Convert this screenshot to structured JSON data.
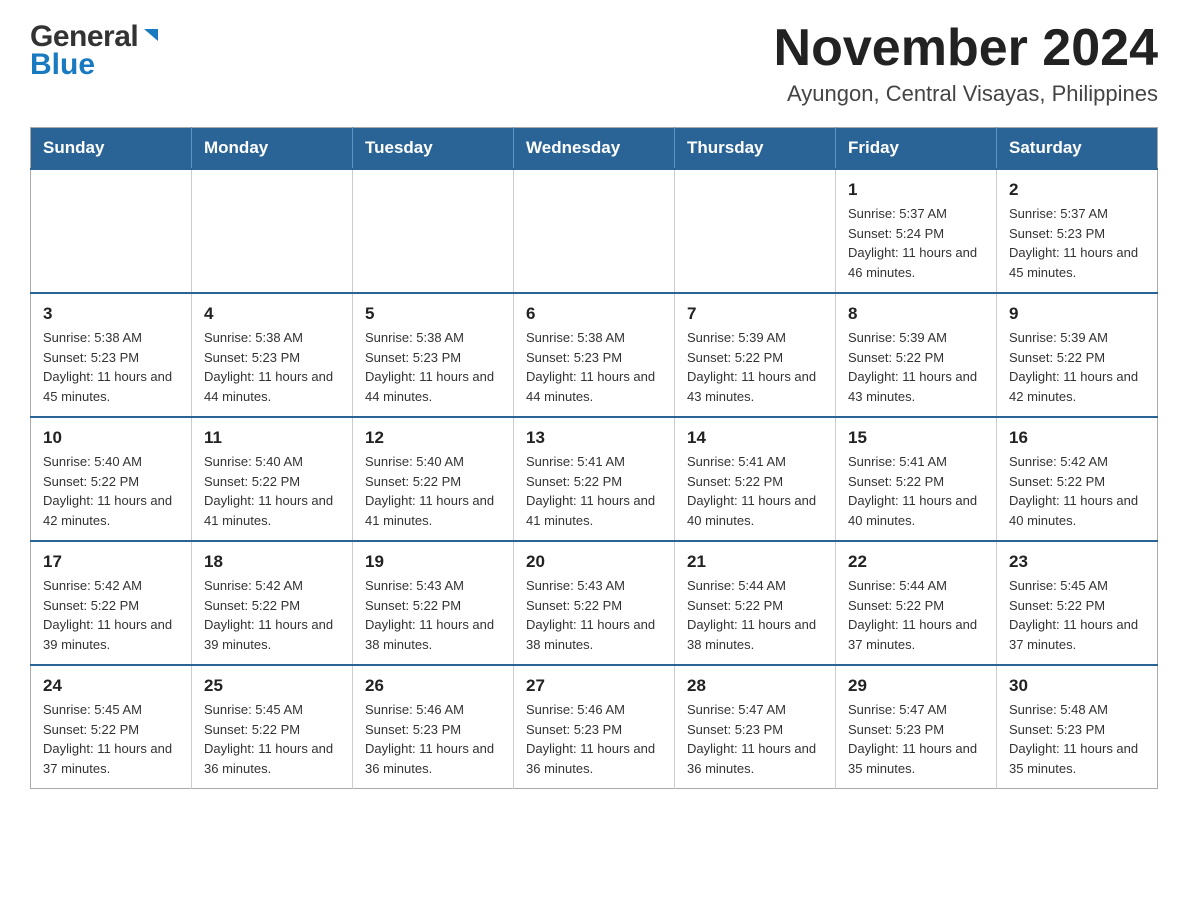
{
  "logo": {
    "general": "General",
    "blue": "Blue"
  },
  "header": {
    "month": "November 2024",
    "location": "Ayungon, Central Visayas, Philippines"
  },
  "weekdays": [
    "Sunday",
    "Monday",
    "Tuesday",
    "Wednesday",
    "Thursday",
    "Friday",
    "Saturday"
  ],
  "weeks": [
    [
      {
        "day": "",
        "info": ""
      },
      {
        "day": "",
        "info": ""
      },
      {
        "day": "",
        "info": ""
      },
      {
        "day": "",
        "info": ""
      },
      {
        "day": "",
        "info": ""
      },
      {
        "day": "1",
        "info": "Sunrise: 5:37 AM\nSunset: 5:24 PM\nDaylight: 11 hours and 46 minutes."
      },
      {
        "day": "2",
        "info": "Sunrise: 5:37 AM\nSunset: 5:23 PM\nDaylight: 11 hours and 45 minutes."
      }
    ],
    [
      {
        "day": "3",
        "info": "Sunrise: 5:38 AM\nSunset: 5:23 PM\nDaylight: 11 hours and 45 minutes."
      },
      {
        "day": "4",
        "info": "Sunrise: 5:38 AM\nSunset: 5:23 PM\nDaylight: 11 hours and 44 minutes."
      },
      {
        "day": "5",
        "info": "Sunrise: 5:38 AM\nSunset: 5:23 PM\nDaylight: 11 hours and 44 minutes."
      },
      {
        "day": "6",
        "info": "Sunrise: 5:38 AM\nSunset: 5:23 PM\nDaylight: 11 hours and 44 minutes."
      },
      {
        "day": "7",
        "info": "Sunrise: 5:39 AM\nSunset: 5:22 PM\nDaylight: 11 hours and 43 minutes."
      },
      {
        "day": "8",
        "info": "Sunrise: 5:39 AM\nSunset: 5:22 PM\nDaylight: 11 hours and 43 minutes."
      },
      {
        "day": "9",
        "info": "Sunrise: 5:39 AM\nSunset: 5:22 PM\nDaylight: 11 hours and 42 minutes."
      }
    ],
    [
      {
        "day": "10",
        "info": "Sunrise: 5:40 AM\nSunset: 5:22 PM\nDaylight: 11 hours and 42 minutes."
      },
      {
        "day": "11",
        "info": "Sunrise: 5:40 AM\nSunset: 5:22 PM\nDaylight: 11 hours and 41 minutes."
      },
      {
        "day": "12",
        "info": "Sunrise: 5:40 AM\nSunset: 5:22 PM\nDaylight: 11 hours and 41 minutes."
      },
      {
        "day": "13",
        "info": "Sunrise: 5:41 AM\nSunset: 5:22 PM\nDaylight: 11 hours and 41 minutes."
      },
      {
        "day": "14",
        "info": "Sunrise: 5:41 AM\nSunset: 5:22 PM\nDaylight: 11 hours and 40 minutes."
      },
      {
        "day": "15",
        "info": "Sunrise: 5:41 AM\nSunset: 5:22 PM\nDaylight: 11 hours and 40 minutes."
      },
      {
        "day": "16",
        "info": "Sunrise: 5:42 AM\nSunset: 5:22 PM\nDaylight: 11 hours and 40 minutes."
      }
    ],
    [
      {
        "day": "17",
        "info": "Sunrise: 5:42 AM\nSunset: 5:22 PM\nDaylight: 11 hours and 39 minutes."
      },
      {
        "day": "18",
        "info": "Sunrise: 5:42 AM\nSunset: 5:22 PM\nDaylight: 11 hours and 39 minutes."
      },
      {
        "day": "19",
        "info": "Sunrise: 5:43 AM\nSunset: 5:22 PM\nDaylight: 11 hours and 38 minutes."
      },
      {
        "day": "20",
        "info": "Sunrise: 5:43 AM\nSunset: 5:22 PM\nDaylight: 11 hours and 38 minutes."
      },
      {
        "day": "21",
        "info": "Sunrise: 5:44 AM\nSunset: 5:22 PM\nDaylight: 11 hours and 38 minutes."
      },
      {
        "day": "22",
        "info": "Sunrise: 5:44 AM\nSunset: 5:22 PM\nDaylight: 11 hours and 37 minutes."
      },
      {
        "day": "23",
        "info": "Sunrise: 5:45 AM\nSunset: 5:22 PM\nDaylight: 11 hours and 37 minutes."
      }
    ],
    [
      {
        "day": "24",
        "info": "Sunrise: 5:45 AM\nSunset: 5:22 PM\nDaylight: 11 hours and 37 minutes."
      },
      {
        "day": "25",
        "info": "Sunrise: 5:45 AM\nSunset: 5:22 PM\nDaylight: 11 hours and 36 minutes."
      },
      {
        "day": "26",
        "info": "Sunrise: 5:46 AM\nSunset: 5:23 PM\nDaylight: 11 hours and 36 minutes."
      },
      {
        "day": "27",
        "info": "Sunrise: 5:46 AM\nSunset: 5:23 PM\nDaylight: 11 hours and 36 minutes."
      },
      {
        "day": "28",
        "info": "Sunrise: 5:47 AM\nSunset: 5:23 PM\nDaylight: 11 hours and 36 minutes."
      },
      {
        "day": "29",
        "info": "Sunrise: 5:47 AM\nSunset: 5:23 PM\nDaylight: 11 hours and 35 minutes."
      },
      {
        "day": "30",
        "info": "Sunrise: 5:48 AM\nSunset: 5:23 PM\nDaylight: 11 hours and 35 minutes."
      }
    ]
  ]
}
